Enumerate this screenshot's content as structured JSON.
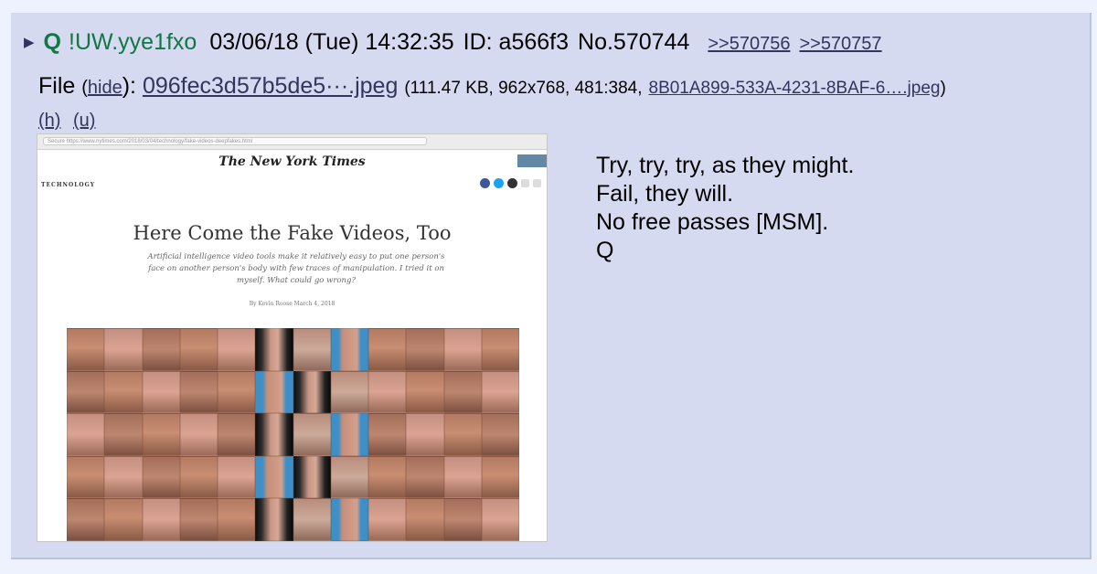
{
  "post": {
    "arrow": "▶",
    "name": "Q",
    "tripcode": "!UW.yye1fxo",
    "date": "03/06/18 (Tue) 14:32:35",
    "id": "ID: a566f3",
    "number": "No.570744",
    "replies": [
      ">>570756",
      ">>570757"
    ]
  },
  "file": {
    "label": "File",
    "hide_link": "hide",
    "hide_before": "(",
    "hide_after": "):",
    "filename": "096fec3d57b5de5···.jpeg",
    "info_before": "(111.47 KB, 962x768, 481:384,",
    "original_name": "8B01A899-533A-4231-8BAF-6….jpeg",
    "info_after": ")",
    "actions": [
      "(h)",
      "(u)"
    ]
  },
  "thumbnail": {
    "site_logo": "The New York Times",
    "section": "TECHNOLOGY",
    "headline": "Here Come the Fake Videos, Too",
    "dek": "Artificial intelligence video tools make it relatively easy to put one person's face on another person's body with few traces of manipulation. I tried it on myself. What could go wrong?",
    "byline": "By Kevin Roose    March 4, 2018",
    "url": "Secure  https://www.nytimes.com/2018/03/04/technology/fake-videos-deepfakes.html",
    "share_colors": [
      "#3b5998",
      "#1da1f2",
      "#333333"
    ]
  },
  "message": {
    "lines": [
      "Try, try, try, as they might.",
      "Fail, they will.",
      "No free passes [MSM].",
      "Q"
    ]
  },
  "colors": {
    "background": "#eef2ff",
    "post_background": "#d6daf0",
    "name_green": "#117743",
    "link": "#34345c"
  }
}
